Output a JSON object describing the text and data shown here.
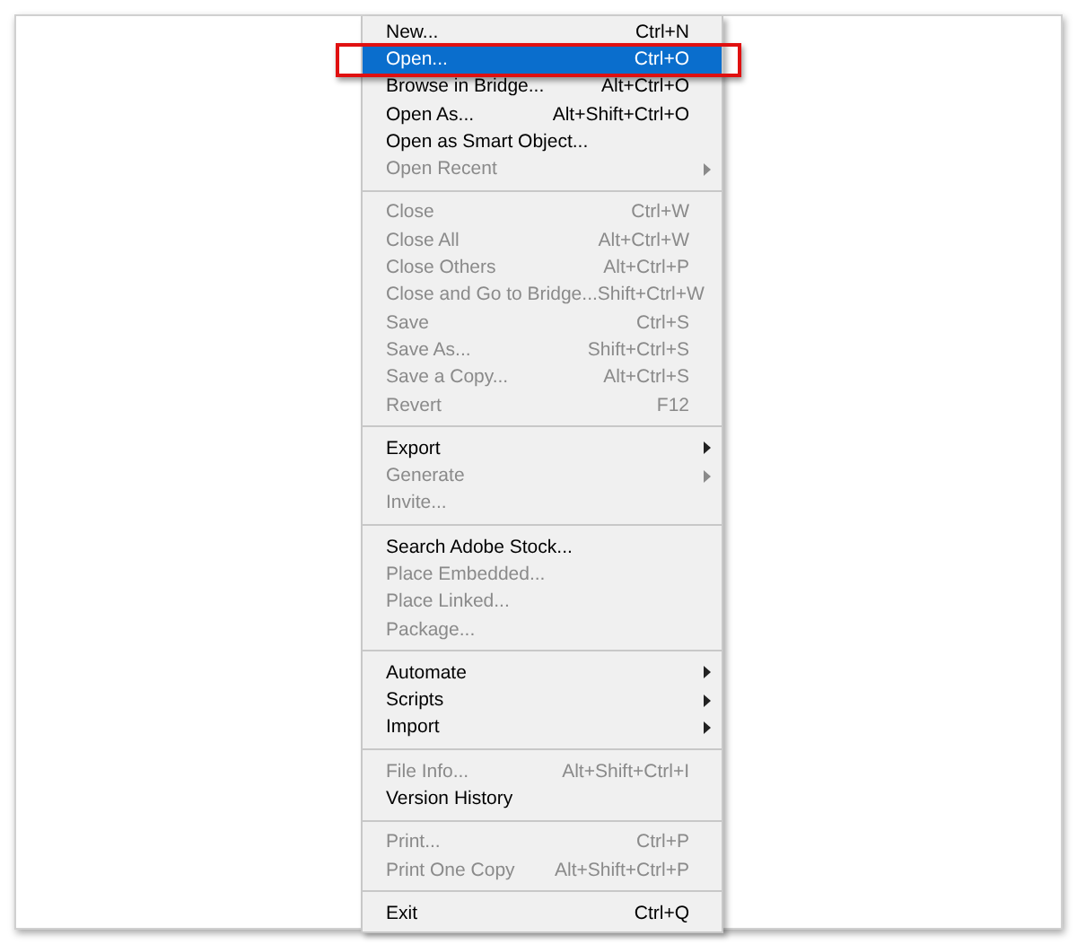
{
  "menu": {
    "groups": [
      {
        "items": [
          {
            "label": "New...",
            "shortcut": "Ctrl+N",
            "disabled": false,
            "submenu": false,
            "selected": false
          },
          {
            "label": "Open...",
            "shortcut": "Ctrl+O",
            "disabled": false,
            "submenu": false,
            "selected": true
          },
          {
            "label": "Browse in Bridge...",
            "shortcut": "Alt+Ctrl+O",
            "disabled": false,
            "submenu": false,
            "selected": false
          },
          {
            "label": "Open As...",
            "shortcut": "Alt+Shift+Ctrl+O",
            "disabled": false,
            "submenu": false,
            "selected": false
          },
          {
            "label": "Open as Smart Object...",
            "disabled": false,
            "submenu": false,
            "selected": false
          },
          {
            "label": "Open Recent",
            "disabled": true,
            "submenu": true,
            "selected": false
          }
        ]
      },
      {
        "items": [
          {
            "label": "Close",
            "shortcut": "Ctrl+W",
            "disabled": true,
            "submenu": false,
            "selected": false
          },
          {
            "label": "Close All",
            "shortcut": "Alt+Ctrl+W",
            "disabled": true,
            "submenu": false,
            "selected": false
          },
          {
            "label": "Close Others",
            "shortcut": "Alt+Ctrl+P",
            "disabled": true,
            "submenu": false,
            "selected": false
          },
          {
            "label": "Close and Go to Bridge...",
            "shortcut": "Shift+Ctrl+W",
            "disabled": true,
            "submenu": false,
            "selected": false
          },
          {
            "label": "Save",
            "shortcut": "Ctrl+S",
            "disabled": true,
            "submenu": false,
            "selected": false
          },
          {
            "label": "Save As...",
            "shortcut": "Shift+Ctrl+S",
            "disabled": true,
            "submenu": false,
            "selected": false
          },
          {
            "label": "Save a Copy...",
            "shortcut": "Alt+Ctrl+S",
            "disabled": true,
            "submenu": false,
            "selected": false
          },
          {
            "label": "Revert",
            "shortcut": "F12",
            "disabled": true,
            "submenu": false,
            "selected": false
          }
        ]
      },
      {
        "items": [
          {
            "label": "Export",
            "disabled": false,
            "submenu": true,
            "selected": false
          },
          {
            "label": "Generate",
            "disabled": true,
            "submenu": true,
            "selected": false
          },
          {
            "label": "Invite...",
            "disabled": true,
            "submenu": false,
            "selected": false
          }
        ]
      },
      {
        "items": [
          {
            "label": "Search Adobe Stock...",
            "disabled": false,
            "submenu": false,
            "selected": false
          },
          {
            "label": "Place Embedded...",
            "disabled": true,
            "submenu": false,
            "selected": false
          },
          {
            "label": "Place Linked...",
            "disabled": true,
            "submenu": false,
            "selected": false
          },
          {
            "label": "Package...",
            "disabled": true,
            "submenu": false,
            "selected": false
          }
        ]
      },
      {
        "items": [
          {
            "label": "Automate",
            "disabled": false,
            "submenu": true,
            "selected": false
          },
          {
            "label": "Scripts",
            "disabled": false,
            "submenu": true,
            "selected": false
          },
          {
            "label": "Import",
            "disabled": false,
            "submenu": true,
            "selected": false
          }
        ]
      },
      {
        "items": [
          {
            "label": "File Info...",
            "shortcut": "Alt+Shift+Ctrl+I",
            "disabled": true,
            "submenu": false,
            "selected": false
          },
          {
            "label": "Version History",
            "disabled": false,
            "submenu": false,
            "selected": false
          }
        ]
      },
      {
        "items": [
          {
            "label": "Print...",
            "shortcut": "Ctrl+P",
            "disabled": true,
            "submenu": false,
            "selected": false
          },
          {
            "label": "Print One Copy",
            "shortcut": "Alt+Shift+Ctrl+P",
            "disabled": true,
            "submenu": false,
            "selected": false
          }
        ]
      },
      {
        "items": [
          {
            "label": "Exit",
            "shortcut": "Ctrl+Q",
            "disabled": false,
            "submenu": false,
            "selected": false
          }
        ]
      }
    ]
  }
}
